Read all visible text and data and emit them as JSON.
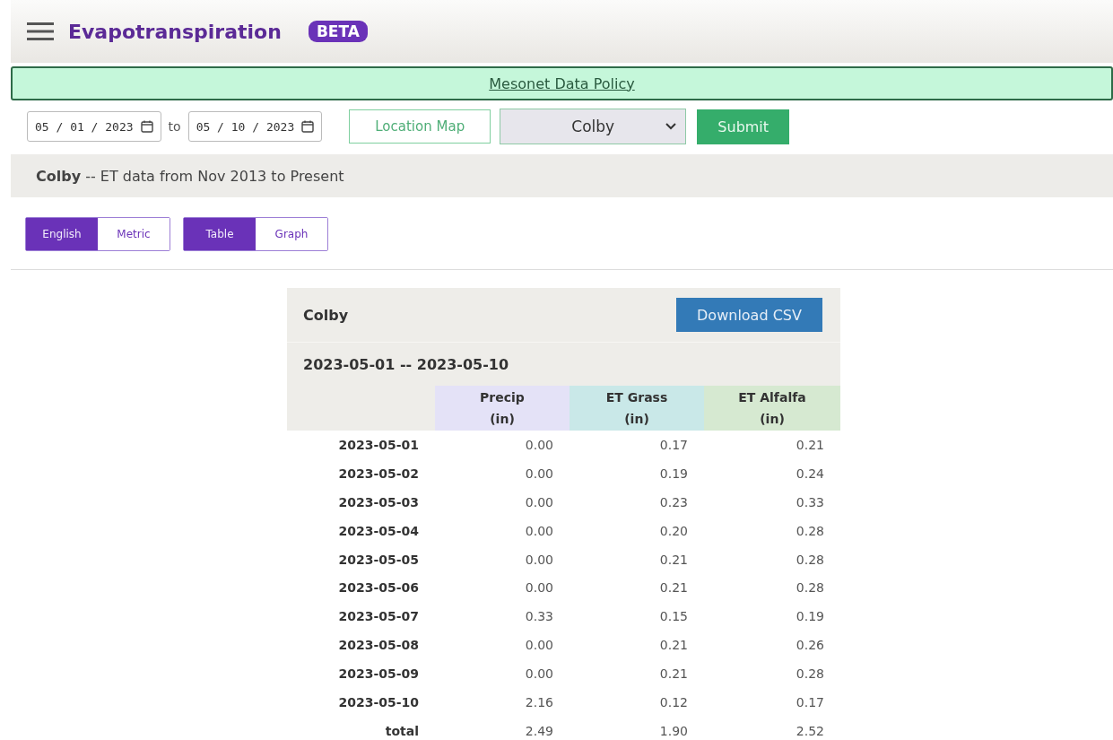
{
  "header": {
    "title": "Evapotranspiration",
    "badge": "BETA"
  },
  "policy_link": "Mesonet Data Policy",
  "controls": {
    "start_date": "05 / 01 / 2023",
    "separator": "to",
    "end_date": "05 / 10 / 2023",
    "map_button": "Location Map",
    "station": "Colby",
    "submit": "Submit"
  },
  "info": {
    "station": "Colby",
    "text": " -- ET data from Nov 2013 to Present"
  },
  "toggles": [
    [
      {
        "label": "English",
        "selected": true
      },
      {
        "label": "Metric",
        "selected": false
      }
    ],
    [
      {
        "label": "Table",
        "selected": true
      },
      {
        "label": "Graph",
        "selected": false
      }
    ]
  ],
  "table": {
    "title": "Colby",
    "download": "Download CSV",
    "range": "2023-05-01 -- 2023-05-10",
    "columns": [
      {
        "name": "Precip",
        "unit": "(in)",
        "color": "#e4e2f7"
      },
      {
        "name": "ET Grass",
        "unit": "(in)",
        "color": "#c9e8e8"
      },
      {
        "name": "ET Alfalfa",
        "unit": "(in)",
        "color": "#d6e9d1"
      }
    ],
    "rows": [
      [
        "2023-05-01",
        "0.00",
        "0.17",
        "0.21"
      ],
      [
        "2023-05-02",
        "0.00",
        "0.19",
        "0.24"
      ],
      [
        "2023-05-03",
        "0.00",
        "0.23",
        "0.33"
      ],
      [
        "2023-05-04",
        "0.00",
        "0.20",
        "0.28"
      ],
      [
        "2023-05-05",
        "0.00",
        "0.21",
        "0.28"
      ],
      [
        "2023-05-06",
        "0.00",
        "0.21",
        "0.28"
      ],
      [
        "2023-05-07",
        "0.33",
        "0.15",
        "0.19"
      ],
      [
        "2023-05-08",
        "0.00",
        "0.21",
        "0.26"
      ],
      [
        "2023-05-09",
        "0.00",
        "0.21",
        "0.28"
      ],
      [
        "2023-05-10",
        "2.16",
        "0.12",
        "0.17"
      ],
      [
        "total",
        "2.49",
        "1.90",
        "2.52"
      ]
    ]
  }
}
